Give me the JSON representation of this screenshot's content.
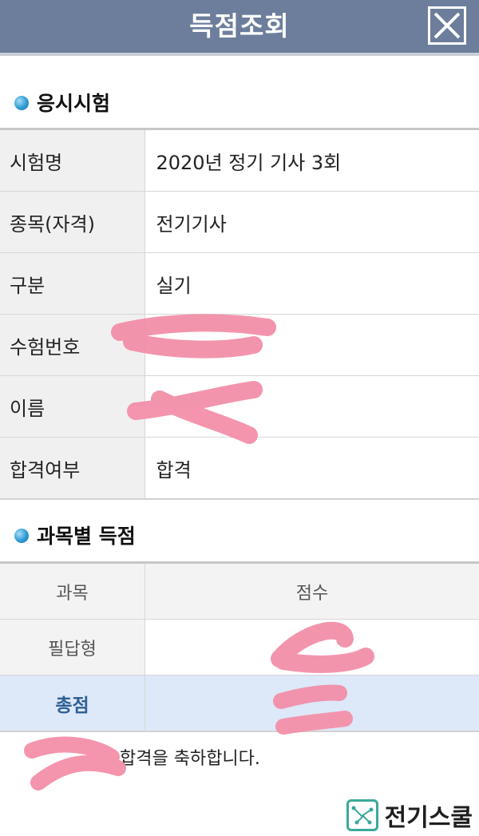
{
  "header": {
    "title": "득점조회"
  },
  "section_exam": {
    "title": "응시시험"
  },
  "exam_info": [
    {
      "label": "시험명",
      "value": "2020년 정기 기사 3회"
    },
    {
      "label": "종목(자격)",
      "value": "전기기사"
    },
    {
      "label": "구분",
      "value": "실기"
    },
    {
      "label": "수험번호",
      "value": ""
    },
    {
      "label": "이름",
      "value": ""
    },
    {
      "label": "합격여부",
      "value": "합격"
    }
  ],
  "section_scores": {
    "title": "과목별 득점"
  },
  "scores": {
    "headers": [
      "과목",
      "점수"
    ],
    "rows": [
      {
        "subject": "필답형",
        "score": ""
      },
      {
        "subject": "총점",
        "score": ""
      }
    ]
  },
  "congrats_text": "합격을 축하합니다.",
  "watermark": {
    "name": "전기스쿨"
  },
  "colors": {
    "header_bg": "#6c7e9b",
    "total_row_bg": "#dde8f8",
    "total_label": "#2e5f95",
    "redaction": "#f38fa9"
  }
}
